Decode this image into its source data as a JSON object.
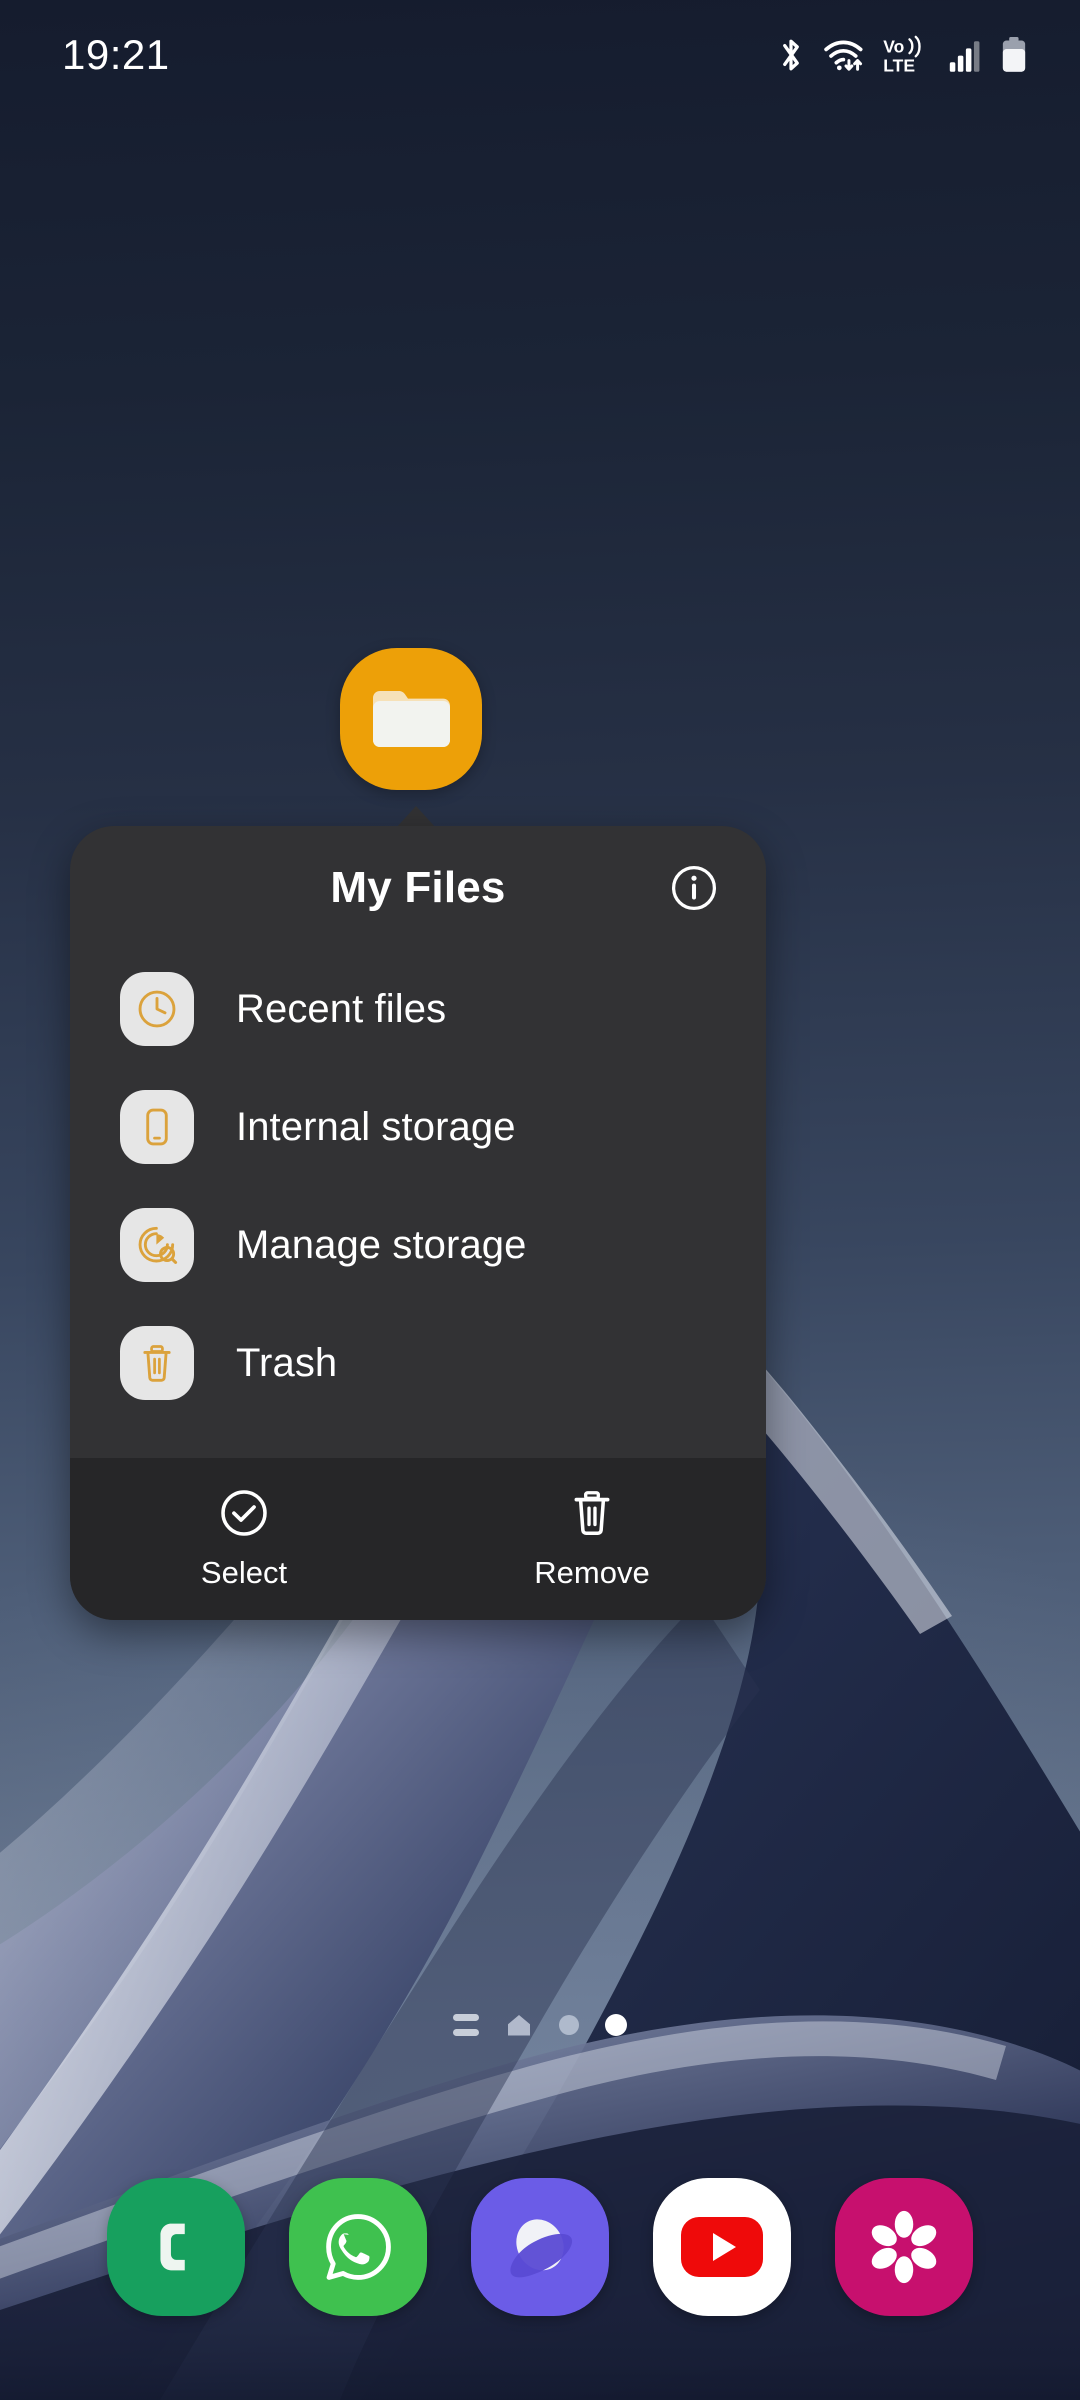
{
  "status_bar": {
    "time": "19:21",
    "icons": [
      {
        "name": "bluetooth-icon"
      },
      {
        "name": "wifi-data-icon"
      },
      {
        "name": "volte-icon",
        "label_top": "Vo))",
        "label_bottom": "LTE"
      },
      {
        "name": "signal-bars-icon"
      },
      {
        "name": "battery-icon"
      }
    ]
  },
  "app_icon": {
    "name": "My Files",
    "color": "#eda008"
  },
  "popup": {
    "title": "My Files",
    "info_label": "i",
    "background": "#323234",
    "items": [
      {
        "label": "Recent files",
        "icon": "clock-icon"
      },
      {
        "label": "Internal storage",
        "icon": "phone-storage-icon"
      },
      {
        "label": "Manage storage",
        "icon": "storage-analysis-icon"
      },
      {
        "label": "Trash",
        "icon": "trash-icon"
      }
    ],
    "item_icon_color": "#dba23c",
    "item_icon_bg": "#e6e6e6",
    "actions": [
      {
        "label": "Select",
        "icon": "check-circle-icon"
      },
      {
        "label": "Remove",
        "icon": "trash-can-icon"
      }
    ]
  },
  "page_indicator": {
    "items": [
      {
        "type": "lines",
        "name": "app-list-indicator",
        "active": false
      },
      {
        "type": "home",
        "name": "home-page-indicator",
        "active": false
      },
      {
        "type": "dot",
        "name": "page-dot-indicator",
        "active": false
      },
      {
        "type": "dot",
        "name": "page-dot-indicator-current",
        "active": true
      }
    ]
  },
  "dock": {
    "apps": [
      {
        "name": "Phone",
        "color": "#17a05e",
        "icon": "phone-icon"
      },
      {
        "name": "WhatsApp",
        "color": "#3fc14f",
        "icon": "whatsapp-icon"
      },
      {
        "name": "Samsung Internet",
        "color": "#6b5ce7",
        "icon": "internet-icon"
      },
      {
        "name": "YouTube",
        "color": "#ffffff",
        "icon": "youtube-icon"
      },
      {
        "name": "Gallery",
        "color": "#c7106e",
        "icon": "gallery-flower-icon"
      }
    ]
  }
}
